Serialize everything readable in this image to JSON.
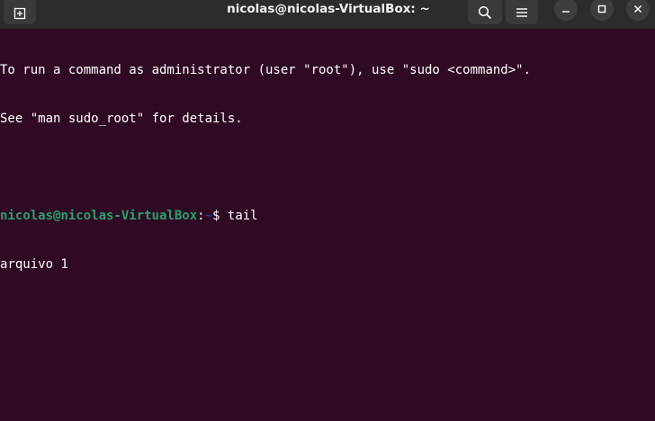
{
  "window": {
    "title": "nicolas@nicolas-VirtualBox: ~"
  },
  "colors": {
    "terminal_bg": "#300a24",
    "titlebar_bg": "#2c2c2c",
    "prompt_user": "#26a269",
    "prompt_path": "#12488b",
    "text": "#ffffff"
  },
  "icons": {
    "new_tab": "new-tab-icon",
    "search": "search-icon",
    "menu": "hamburger-menu-icon",
    "minimize": "minimize-icon",
    "maximize": "maximize-icon",
    "close": "close-icon"
  },
  "terminal": {
    "intro_line_1": "To run a command as administrator (user \"root\"), use \"sudo <command>\".",
    "intro_line_2": "See \"man sudo_root\" for details.",
    "prompt": {
      "user_host": "nicolas@nicolas-VirtualBox",
      "separator": ":",
      "path": "~",
      "symbol": "$ ",
      "command": "tail"
    },
    "output_line_1": "arquivo 1"
  }
}
